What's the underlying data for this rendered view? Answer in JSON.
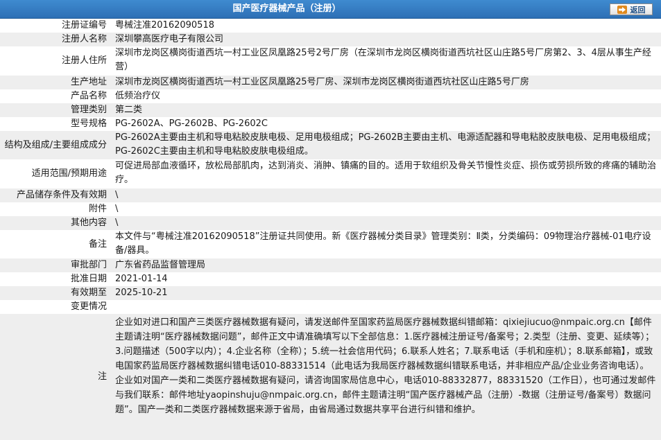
{
  "header": {
    "title": "国产医疗器械产品（注册）",
    "back_label": "返回"
  },
  "rows": [
    {
      "label": "注册证编号",
      "value": "粤械注准20162090518"
    },
    {
      "label": "注册人名称",
      "value": "深圳攀高医疗电子有限公司"
    },
    {
      "label": "注册人住所",
      "value": "深圳市龙岗区横岗街道西坑一村工业区凤凰路25号2号厂房（在深圳市龙岗区横岗街道西坑社区山庄路5号厂房第2、3、4层从事生产经营）"
    },
    {
      "label": "生产地址",
      "value": "深圳市龙岗区横岗街道西坑一村工业区凤凰路25号厂房、深圳市龙岗区横岗街道西坑社区山庄路5号厂房"
    },
    {
      "label": "产品名称",
      "value": "低频治疗仪"
    },
    {
      "label": "管理类别",
      "value": "第二类"
    },
    {
      "label": "型号规格",
      "value": "PG-2602A、PG-2602B、PG-2602C"
    },
    {
      "label": "结构及组成/主要组成成分",
      "value": "PG-2602A主要由主机和导电粘胶皮肤电极、足用电极组成；PG-2602B主要由主机、电源适配器和导电粘胶皮肤电极、足用电极组成；PG-2602C主要由主机和导电粘胶皮肤电极组成。"
    },
    {
      "label": "适用范围/预期用途",
      "value": "可促进局部血液循环，放松局部肌肉，达到消炎、消肿、镇痛的目的。适用于软组织及骨关节慢性炎症、损伤或劳损所致的疼痛的辅助治疗。"
    },
    {
      "label": "产品储存条件及有效期",
      "value": "\\"
    },
    {
      "label": "附件",
      "value": "\\"
    },
    {
      "label": "其他内容",
      "value": "\\"
    },
    {
      "label": "备注",
      "value": "本文件与“粤械注准20162090518”注册证共同使用。新《医疗器械分类目录》管理类别：Ⅱ类，分类编码：09物理治疗器械-01电疗设备/器具。"
    },
    {
      "label": "审批部门",
      "value": "广东省药品监督管理局"
    },
    {
      "label": "批准日期",
      "value": "2021-01-14"
    },
    {
      "label": "有效期至",
      "value": "2025-10-21"
    },
    {
      "label": "变更情况",
      "value": ""
    },
    {
      "label": "注",
      "value": "企业如对进口和国产三类医疗器械数据有疑问，请发送邮件至国家药监局医疗器械数据纠错邮箱：qixiejiucuo@nmpaic.org.cn【邮件主题请注明“医疗器械数据问题”，邮件正文中请准确填写以下全部信息：1.医疗器械注册证号/备案号；2.类型（注册、变更、延续等）；3.问题描述（500字以内）；4.企业名称（全称）；5.统一社会信用代码；6.联系人姓名；7.联系电话（手机和座机）；8.联系邮箱】，或致电国家药监局医疗器械数据纠错电话010-88331514（此电话为我局医疗器械数据纠错联系电话，并非相应产品/企业业务咨询电话）。企业如对国产一类和二类医疗器械数据有疑问，请咨询国家局信息中心，电话010-88332877，88331520（工作日），也可通过发邮件与我们联系：邮件地址yaopinshuju@nmpaic.org.cn，邮件主题请注明“国产医疗器械产品（注册）-数据（注册证号/备案号）数据问题”。国产一类和二类医疗器械数据来源于省局，由省局通过数据共享平台进行纠错和维护。"
    }
  ]
}
